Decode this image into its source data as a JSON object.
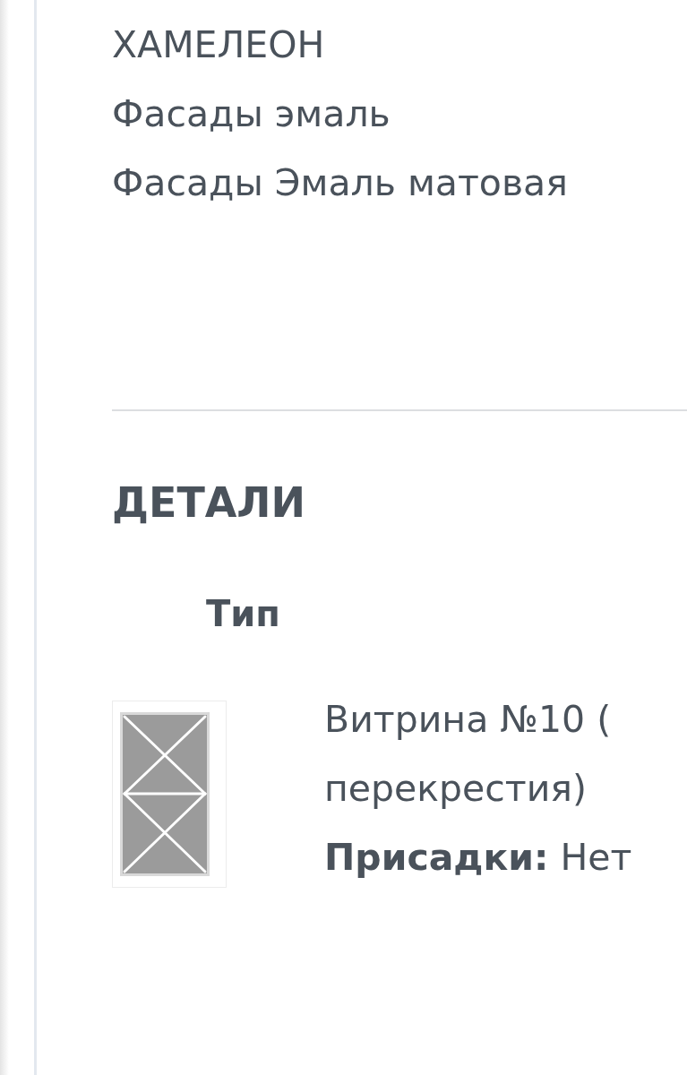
{
  "category_lines": [
    "ХАМЕЛЕОН",
    "Фасады эмаль",
    "Фасады Эмаль матовая"
  ],
  "details": {
    "title": "ДЕТАЛИ",
    "column_header": "Тип",
    "items": [
      {
        "name_lines": [
          "Витрина №10 (",
          "перекрестия)"
        ],
        "spec": "**Присадки:** Нет"
      }
    ]
  }
}
